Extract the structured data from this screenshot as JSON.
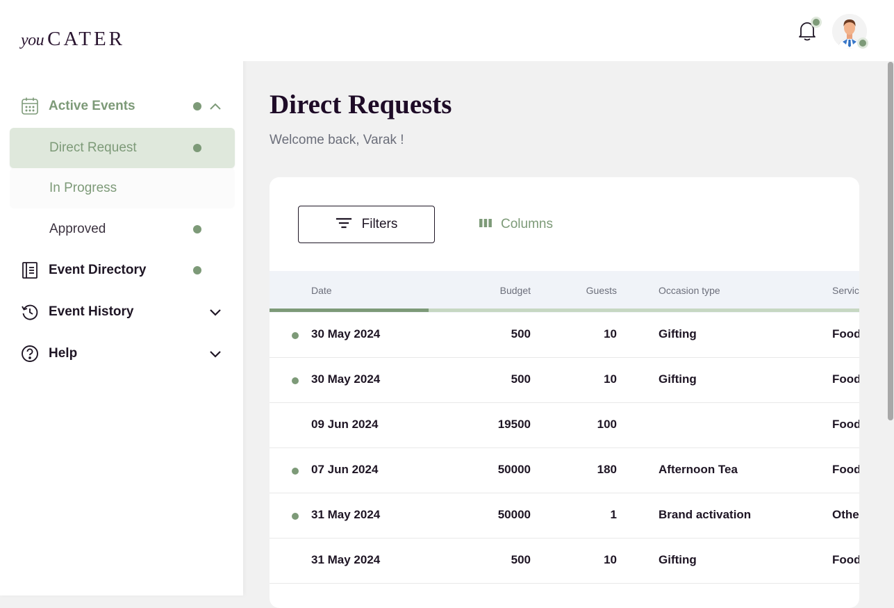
{
  "brand": {
    "logo_script": "you",
    "logo_main": "CATER"
  },
  "sidebar": {
    "active_events": {
      "label": "Active Events",
      "has_dot": true,
      "expanded": true,
      "icon": "calendar-icon"
    },
    "sub_items": [
      {
        "label": "Direct Request",
        "has_dot": true,
        "selected": true
      },
      {
        "label": "In Progress",
        "has_dot": false,
        "selected": false
      },
      {
        "label": "Approved",
        "has_dot": true,
        "selected": false
      }
    ],
    "event_directory": {
      "label": "Event Directory",
      "has_dot": true,
      "icon": "directory-icon"
    },
    "event_history": {
      "label": "Event History",
      "icon": "history-icon"
    },
    "help": {
      "label": "Help",
      "icon": "help-icon"
    }
  },
  "header": {
    "notifications_icon": "bell-icon",
    "avatar_icon": "user-avatar"
  },
  "page": {
    "title": "Direct Requests",
    "welcome": "Welcome back, Varak !"
  },
  "toolbar": {
    "filters_label": "Filters",
    "columns_label": "Columns"
  },
  "table": {
    "columns": [
      "Date",
      "Budget",
      "Guests",
      "Occasion type",
      "Servic"
    ],
    "scroll_progress": 0.27,
    "rows": [
      {
        "dot": true,
        "date": "30 May 2024",
        "budget": "500",
        "guests": "10",
        "occasion": "Gifting",
        "service": "Food"
      },
      {
        "dot": true,
        "date": "30 May 2024",
        "budget": "500",
        "guests": "10",
        "occasion": "Gifting",
        "service": "Food"
      },
      {
        "dot": false,
        "date": "09 Jun 2024",
        "budget": "19500",
        "guests": "100",
        "occasion": "",
        "service": "Food"
      },
      {
        "dot": true,
        "date": "07 Jun 2024",
        "budget": "50000",
        "guests": "180",
        "occasion": "Afternoon Tea",
        "service": "Food"
      },
      {
        "dot": true,
        "date": "31 May 2024",
        "budget": "50000",
        "guests": "1",
        "occasion": "Brand activation",
        "service": "Othe"
      },
      {
        "dot": false,
        "date": "31 May 2024",
        "budget": "500",
        "guests": "10",
        "occasion": "Gifting",
        "service": "Food"
      }
    ]
  },
  "colors": {
    "accent": "#7d9a78",
    "accent_light": "#dfe8dc",
    "text_dark": "#1e1524",
    "muted": "#6b6e7a",
    "background": "#f1f1f1"
  }
}
